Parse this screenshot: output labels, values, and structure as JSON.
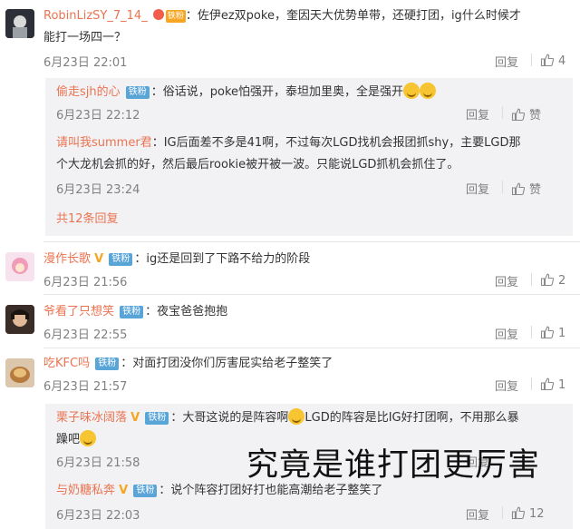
{
  "comments": [
    {
      "user": "RobinLizSY_7_14_",
      "fan_badge": "铁粉",
      "text_line1": "：佐伊ez双poke，奎因天大优势单带，还硬打团，ig什么时候才",
      "text_line2": "能打一场四一？",
      "time": "6月23日 22:01",
      "reply": "回复",
      "likes": "4",
      "replies": [
        {
          "user": "偷走sjh的心",
          "fan_badge": "铁粉",
          "text": "：俗话说，poke怕强开，泰坦加里奥，全是强开",
          "time": "6月23日 22:12",
          "reply": "回复",
          "like_label": "赞"
        },
        {
          "user": "请叫我summer君",
          "text_line1": "：IG后面差不多是41啊，不过每次LGD找机会报团抓shy，主要LGD那",
          "text_line2": "个大龙机会抓的好，然后最后rookie被开被一波。只能说LGD抓机会抓住了。",
          "time": "6月23日 23:24",
          "reply": "回复",
          "like_label": "赞"
        }
      ],
      "more_replies": "共12条回复"
    },
    {
      "user": "漫作长歌",
      "v_label": "V",
      "fan_badge": "铁粉",
      "text": "：ig还是回到了下路不给力的阶段",
      "time": "6月23日 21:56",
      "reply": "回复",
      "likes": "2"
    },
    {
      "user": "爷看了只想笑",
      "fan_badge": "铁粉",
      "text": "：夜宝爸爸抱抱",
      "time": "6月23日 22:55",
      "reply": "回复",
      "likes": "1"
    },
    {
      "user": "吃KFC吗",
      "fan_badge": "铁粉",
      "text": "：对面打团没你们厉害屁实给老子整笑了",
      "time": "6月23日 21:57",
      "reply": "回复",
      "likes": "1",
      "replies": [
        {
          "user": "栗子味冰阔落",
          "v_label": "V",
          "fan_badge": "铁粉",
          "text_a": "：大哥这说的是阵容啊",
          "text_b": "LGD的阵容是比IG好打团啊，不用那么暴",
          "text_line2": "躁吧",
          "time": "6月23日 21:58",
          "reply": "回复"
        },
        {
          "user": "与奶糖私奔",
          "v_label": "V",
          "fan_badge": "铁粉",
          "text": "：说个阵容打团好打也能高潮给老子整笑了",
          "time": "6月23日 22:03",
          "reply": "回复",
          "likes": "12"
        }
      ]
    }
  ],
  "watermark": "究竟是谁打团更厉害",
  "colors": {
    "name": "#eb7350",
    "fan_badge": "#5aa5d8",
    "meta": "#808080",
    "reply_bg": "#f2f2f5"
  }
}
